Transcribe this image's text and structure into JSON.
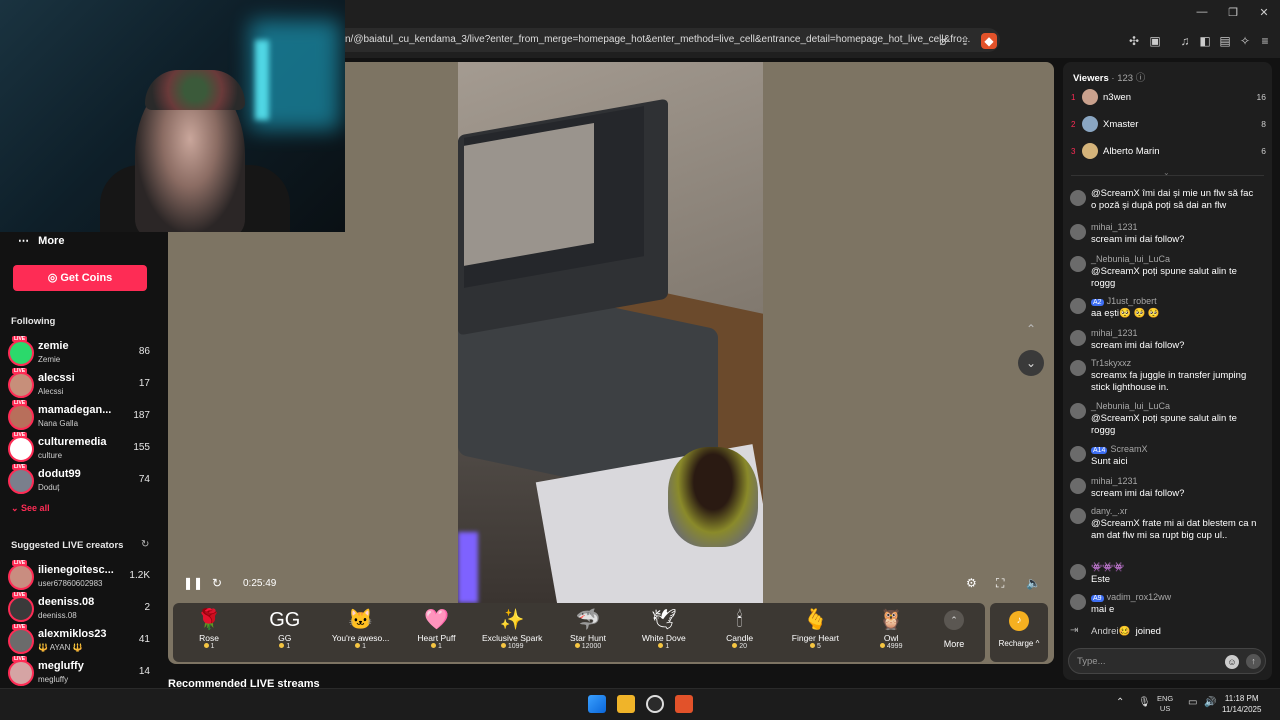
{
  "browser": {
    "url": "n/@baiatul_cu_kendama_3/live?enter_from_merge=homepage_hot&enter_method=live_cell&entrance_detail=homepage_hot_live_cell&fro..."
  },
  "sidebar": {
    "more_label": "More",
    "get_coins_label": "Get Coins",
    "following_title": "Following",
    "following": [
      {
        "name": "zemie",
        "sub": "Zemie",
        "count": "86",
        "color": "#2bd96b"
      },
      {
        "name": "alecssi",
        "sub": "Alecssi",
        "count": "17",
        "color": "#c78f7a"
      },
      {
        "name": "mamadegan...",
        "sub": "Nana Galla",
        "count": "187",
        "color": "#b86f5b"
      },
      {
        "name": "culturemedia",
        "sub": "culture",
        "count": "155",
        "color": "#ffffff"
      },
      {
        "name": "dodut99",
        "sub": "Doduț",
        "count": "74",
        "color": "#7a7f8c"
      }
    ],
    "see_all_label": "See all",
    "suggested_title": "Suggested LIVE creators",
    "suggested": [
      {
        "name": "ilienegoitesc...",
        "sub": "user67860602983",
        "count": "1.2K",
        "color": "#c98d80"
      },
      {
        "name": "deeniss.08",
        "sub": "deeniss.08",
        "count": "2",
        "color": "#3a3a3a"
      },
      {
        "name": "alexmiklos23",
        "sub": "🔱 AYAN 🔱",
        "count": "41",
        "color": "#6b6b6b"
      },
      {
        "name": "megluffy",
        "sub": "megluffy",
        "count": "14",
        "color": "#d5a4a4"
      }
    ]
  },
  "player": {
    "timer": "0:25:49"
  },
  "gifts": [
    {
      "name": "Rose",
      "price": "1",
      "icon": "🌹"
    },
    {
      "name": "GG",
      "price": "1",
      "icon": "GG"
    },
    {
      "name": "You're aweso...",
      "price": "1",
      "icon": "🐱"
    },
    {
      "name": "Heart Puff",
      "price": "1",
      "icon": "🩷"
    },
    {
      "name": "Exclusive Spark",
      "price": "1099",
      "icon": "✨"
    },
    {
      "name": "Star Hunt",
      "price": "12000",
      "icon": "🦈"
    },
    {
      "name": "White Dove",
      "price": "1",
      "icon": "🕊"
    },
    {
      "name": "Candle",
      "price": "20",
      "icon": "🕯"
    },
    {
      "name": "Finger Heart",
      "price": "5",
      "icon": "🫰"
    },
    {
      "name": "Owl",
      "price": "4999",
      "icon": "🦉"
    }
  ],
  "gifts_more_label": "More",
  "recharge_label": "Recharge ^",
  "recommended_title": "Recommended LIVE streams",
  "chat": {
    "viewers_label": "Viewers",
    "viewers_count": "· 123",
    "top_viewers": [
      {
        "rank": "1",
        "name": "n3wen",
        "score": "16"
      },
      {
        "rank": "2",
        "name": "Xmaster",
        "score": "8"
      },
      {
        "rank": "3",
        "name": "Alberto Marin",
        "score": "6"
      }
    ],
    "messages": [
      {
        "user": "",
        "badge": "",
        "text": "@ScreamX îmi dai și mie un flw să fac o poză și după poți să dai an flw"
      },
      {
        "user": "mihai_1231",
        "badge": "",
        "text": "scream imi dai follow?"
      },
      {
        "user": "_Nebunia_lui_LuCa",
        "badge": "",
        "text": "@ScreamX poți spune salut alin te roggg"
      },
      {
        "user": "J1ust_robert",
        "badge": "A2",
        "text": "aa ești🥺 🥺 🥺"
      },
      {
        "user": "mihai_1231",
        "badge": "",
        "text": "scream imi dai follow?"
      },
      {
        "user": "Tr1skyxxz",
        "badge": "",
        "text": "screamx fa juggle in transfer jumping stick lighthouse in."
      },
      {
        "user": "_Nebunia_lui_LuCa",
        "badge": "",
        "text": "@ScreamX poți spune salut alin te roggg"
      },
      {
        "user": "ScreamX",
        "badge": "A14",
        "text": "Sunt aici"
      },
      {
        "user": "mihai_1231",
        "badge": "",
        "text": "scream imi dai follow?"
      },
      {
        "user": "dany._.xr",
        "badge": "",
        "text": "@ScreamX frate mi ai dat blestem ca n am dat flw mi sa rupt big cup ul.."
      },
      {
        "user": "👾👾👾",
        "badge": "",
        "text": "Este"
      },
      {
        "user": "vadim_rox12ww",
        "badge": "A9",
        "text": "mai e"
      }
    ],
    "joined_user": "Andrei🥴",
    "joined_text": "joined",
    "input_placeholder": "Type..."
  },
  "taskbar": {
    "lang_top": "ENG",
    "lang_bottom": "US",
    "time": "11:18 PM",
    "date": "11/14/2025"
  }
}
